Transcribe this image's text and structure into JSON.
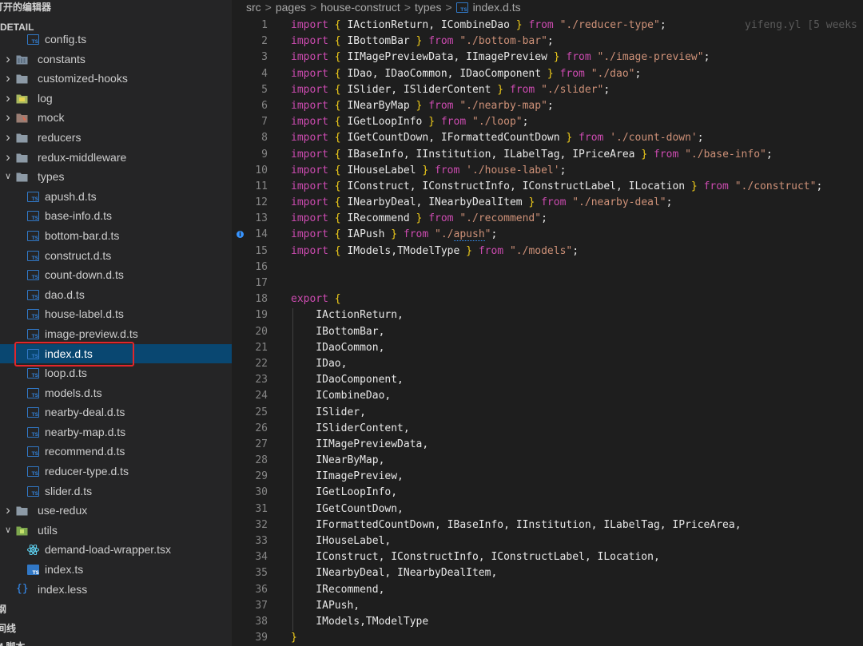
{
  "sidebar": {
    "open_editors_title": "打开的编辑器",
    "project_title": "-DETAIL",
    "outline_title": "纲",
    "timeline_title": "间线",
    "npm_title": "M 脚本",
    "items": [
      {
        "label": "config.ts",
        "kind": "ts",
        "depth": 2
      },
      {
        "label": "constants",
        "kind": "folder-blue",
        "depth": 1,
        "expand": "closed"
      },
      {
        "label": "customized-hooks",
        "kind": "folder",
        "depth": 1,
        "expand": "closed"
      },
      {
        "label": "log",
        "kind": "folder-log",
        "depth": 1,
        "expand": "closed"
      },
      {
        "label": "mock",
        "kind": "folder-mock",
        "depth": 1,
        "expand": "closed"
      },
      {
        "label": "reducers",
        "kind": "folder",
        "depth": 1,
        "expand": "closed"
      },
      {
        "label": "redux-middleware",
        "kind": "folder",
        "depth": 1,
        "expand": "closed"
      },
      {
        "label": "types",
        "kind": "folder",
        "depth": 1,
        "expand": "open"
      },
      {
        "label": "apush.d.ts",
        "kind": "ts",
        "depth": 2
      },
      {
        "label": "base-info.d.ts",
        "kind": "ts",
        "depth": 2
      },
      {
        "label": "bottom-bar.d.ts",
        "kind": "ts",
        "depth": 2
      },
      {
        "label": "construct.d.ts",
        "kind": "ts",
        "depth": 2
      },
      {
        "label": "count-down.d.ts",
        "kind": "ts",
        "depth": 2
      },
      {
        "label": "dao.d.ts",
        "kind": "ts",
        "depth": 2
      },
      {
        "label": "house-label.d.ts",
        "kind": "ts",
        "depth": 2
      },
      {
        "label": "image-preview.d.ts",
        "kind": "ts",
        "depth": 2
      },
      {
        "label": "index.d.ts",
        "kind": "ts",
        "depth": 2,
        "selected": true
      },
      {
        "label": "loop.d.ts",
        "kind": "ts",
        "depth": 2
      },
      {
        "label": "models.d.ts",
        "kind": "ts",
        "depth": 2
      },
      {
        "label": "nearby-deal.d.ts",
        "kind": "ts",
        "depth": 2
      },
      {
        "label": "nearby-map.d.ts",
        "kind": "ts",
        "depth": 2
      },
      {
        "label": "recommend.d.ts",
        "kind": "ts",
        "depth": 2
      },
      {
        "label": "reducer-type.d.ts",
        "kind": "ts",
        "depth": 2
      },
      {
        "label": "slider.d.ts",
        "kind": "ts",
        "depth": 2
      },
      {
        "label": "use-redux",
        "kind": "folder",
        "depth": 1,
        "expand": "closed"
      },
      {
        "label": "utils",
        "kind": "folder-utils",
        "depth": 1,
        "expand": "open"
      },
      {
        "label": "demand-load-wrapper.tsx",
        "kind": "react",
        "depth": 2
      },
      {
        "label": "index.ts",
        "kind": "ts-solid",
        "depth": 2
      },
      {
        "label": "index.less",
        "kind": "braces",
        "depth": 1
      }
    ],
    "ts_badge": "TS",
    "braces_glyph": "{}"
  },
  "breadcrumb": {
    "items": [
      "src",
      "pages",
      "house-construct",
      "types",
      "index.d.ts"
    ],
    "separator": ">",
    "file_badge": "TS"
  },
  "editor": {
    "blame_text": "yifeng.yl [5 weeks",
    "info_glyph": "i",
    "info_line": 14,
    "lines": [
      {
        "n": "1",
        "seg": [
          [
            "kw",
            "import"
          ],
          [
            "t",
            " "
          ],
          [
            "br",
            "{"
          ],
          [
            "t",
            " IActionReturn, ICombineDao "
          ],
          [
            "br",
            "}"
          ],
          [
            "t",
            " "
          ],
          [
            "kw",
            "from"
          ],
          [
            "t",
            " "
          ],
          [
            "str",
            "\"./reducer-type\""
          ],
          [
            "t",
            ";"
          ]
        ]
      },
      {
        "n": "2",
        "seg": [
          [
            "kw",
            "import"
          ],
          [
            "t",
            " "
          ],
          [
            "br",
            "{"
          ],
          [
            "t",
            " IBottomBar "
          ],
          [
            "br",
            "}"
          ],
          [
            "t",
            " "
          ],
          [
            "kw",
            "from"
          ],
          [
            "t",
            " "
          ],
          [
            "str",
            "\"./bottom-bar\""
          ],
          [
            "t",
            ";"
          ]
        ]
      },
      {
        "n": "3",
        "seg": [
          [
            "kw",
            "import"
          ],
          [
            "t",
            " "
          ],
          [
            "br",
            "{"
          ],
          [
            "t",
            " IIMagePreviewData, IImagePreview "
          ],
          [
            "br",
            "}"
          ],
          [
            "t",
            " "
          ],
          [
            "kw",
            "from"
          ],
          [
            "t",
            " "
          ],
          [
            "str",
            "\"./image-preview\""
          ],
          [
            "t",
            ";"
          ]
        ]
      },
      {
        "n": "4",
        "seg": [
          [
            "kw",
            "import"
          ],
          [
            "t",
            " "
          ],
          [
            "br",
            "{"
          ],
          [
            "t",
            " IDao, IDaoCommon, IDaoComponent "
          ],
          [
            "br",
            "}"
          ],
          [
            "t",
            " "
          ],
          [
            "kw",
            "from"
          ],
          [
            "t",
            " "
          ],
          [
            "str",
            "\"./dao\""
          ],
          [
            "t",
            ";"
          ]
        ]
      },
      {
        "n": "5",
        "seg": [
          [
            "kw",
            "import"
          ],
          [
            "t",
            " "
          ],
          [
            "br",
            "{"
          ],
          [
            "t",
            " ISlider, ISliderContent "
          ],
          [
            "br",
            "}"
          ],
          [
            "t",
            " "
          ],
          [
            "kw",
            "from"
          ],
          [
            "t",
            " "
          ],
          [
            "str",
            "\"./slider\""
          ],
          [
            "t",
            ";"
          ]
        ]
      },
      {
        "n": "6",
        "seg": [
          [
            "kw",
            "import"
          ],
          [
            "t",
            " "
          ],
          [
            "br",
            "{"
          ],
          [
            "t",
            " INearByMap "
          ],
          [
            "br",
            "}"
          ],
          [
            "t",
            " "
          ],
          [
            "kw",
            "from"
          ],
          [
            "t",
            " "
          ],
          [
            "str",
            "\"./nearby-map\""
          ],
          [
            "t",
            ";"
          ]
        ]
      },
      {
        "n": "7",
        "seg": [
          [
            "kw",
            "import"
          ],
          [
            "t",
            " "
          ],
          [
            "br",
            "{"
          ],
          [
            "t",
            " IGetLoopInfo "
          ],
          [
            "br",
            "}"
          ],
          [
            "t",
            " "
          ],
          [
            "kw",
            "from"
          ],
          [
            "t",
            " "
          ],
          [
            "str",
            "\"./loop\""
          ],
          [
            "t",
            ";"
          ]
        ]
      },
      {
        "n": "8",
        "seg": [
          [
            "kw",
            "import"
          ],
          [
            "t",
            " "
          ],
          [
            "br",
            "{"
          ],
          [
            "t",
            " IGetCountDown, IFormattedCountDown "
          ],
          [
            "br",
            "}"
          ],
          [
            "t",
            " "
          ],
          [
            "kw",
            "from"
          ],
          [
            "t",
            " "
          ],
          [
            "str",
            "'./count-down'"
          ],
          [
            "t",
            ";"
          ]
        ]
      },
      {
        "n": "9",
        "seg": [
          [
            "kw",
            "import"
          ],
          [
            "t",
            " "
          ],
          [
            "br",
            "{"
          ],
          [
            "t",
            " IBaseInfo, IInstitution, ILabelTag, IPriceArea "
          ],
          [
            "br",
            "}"
          ],
          [
            "t",
            " "
          ],
          [
            "kw",
            "from"
          ],
          [
            "t",
            " "
          ],
          [
            "str",
            "\"./base-info\""
          ],
          [
            "t",
            ";"
          ]
        ]
      },
      {
        "n": "10",
        "seg": [
          [
            "kw",
            "import"
          ],
          [
            "t",
            " "
          ],
          [
            "br",
            "{"
          ],
          [
            "t",
            " IHouseLabel "
          ],
          [
            "br",
            "}"
          ],
          [
            "t",
            " "
          ],
          [
            "kw",
            "from"
          ],
          [
            "t",
            " "
          ],
          [
            "str",
            "'./house-label'"
          ],
          [
            "t",
            ";"
          ]
        ]
      },
      {
        "n": "11",
        "seg": [
          [
            "kw",
            "import"
          ],
          [
            "t",
            " "
          ],
          [
            "br",
            "{"
          ],
          [
            "t",
            " IConstruct, IConstructInfo, IConstructLabel, ILocation "
          ],
          [
            "br",
            "}"
          ],
          [
            "t",
            " "
          ],
          [
            "kw",
            "from"
          ],
          [
            "t",
            " "
          ],
          [
            "str",
            "\"./construct\""
          ],
          [
            "t",
            ";"
          ]
        ]
      },
      {
        "n": "12",
        "seg": [
          [
            "kw",
            "import"
          ],
          [
            "t",
            " "
          ],
          [
            "br",
            "{"
          ],
          [
            "t",
            " INearbyDeal, INearbyDealItem "
          ],
          [
            "br",
            "}"
          ],
          [
            "t",
            " "
          ],
          [
            "kw",
            "from"
          ],
          [
            "t",
            " "
          ],
          [
            "str",
            "\"./nearby-deal\""
          ],
          [
            "t",
            ";"
          ]
        ]
      },
      {
        "n": "13",
        "seg": [
          [
            "kw",
            "import"
          ],
          [
            "t",
            " "
          ],
          [
            "br",
            "{"
          ],
          [
            "t",
            " IRecommend "
          ],
          [
            "br",
            "}"
          ],
          [
            "t",
            " "
          ],
          [
            "kw",
            "from"
          ],
          [
            "t",
            " "
          ],
          [
            "str",
            "\"./recommend\""
          ],
          [
            "t",
            ";"
          ]
        ]
      },
      {
        "n": "14",
        "seg": [
          [
            "kw",
            "import"
          ],
          [
            "t",
            " "
          ],
          [
            "br",
            "{"
          ],
          [
            "t",
            " IAPush "
          ],
          [
            "br",
            "}"
          ],
          [
            "t",
            " "
          ],
          [
            "kw",
            "from"
          ],
          [
            "t",
            " "
          ],
          [
            "str",
            "\"./"
          ],
          [
            "sq",
            "apush"
          ],
          [
            "str",
            "\""
          ],
          [
            "t",
            ";"
          ]
        ]
      },
      {
        "n": "15",
        "seg": [
          [
            "kw",
            "import"
          ],
          [
            "t",
            " "
          ],
          [
            "br",
            "{"
          ],
          [
            "t",
            " IModels,TModelType "
          ],
          [
            "br",
            "}"
          ],
          [
            "t",
            " "
          ],
          [
            "kw",
            "from"
          ],
          [
            "t",
            " "
          ],
          [
            "str",
            "\"./models\""
          ],
          [
            "t",
            ";"
          ]
        ]
      },
      {
        "n": "16",
        "seg": []
      },
      {
        "n": "17",
        "seg": []
      },
      {
        "n": "18",
        "seg": [
          [
            "kw",
            "export"
          ],
          [
            "t",
            " "
          ],
          [
            "br",
            "{"
          ]
        ]
      },
      {
        "n": "19",
        "seg": [
          [
            "t",
            "    IActionReturn,"
          ]
        ]
      },
      {
        "n": "20",
        "seg": [
          [
            "t",
            "    IBottomBar,"
          ]
        ]
      },
      {
        "n": "21",
        "seg": [
          [
            "t",
            "    IDaoCommon,"
          ]
        ]
      },
      {
        "n": "22",
        "seg": [
          [
            "t",
            "    IDao,"
          ]
        ]
      },
      {
        "n": "23",
        "seg": [
          [
            "t",
            "    IDaoComponent,"
          ]
        ]
      },
      {
        "n": "24",
        "seg": [
          [
            "t",
            "    ICombineDao,"
          ]
        ]
      },
      {
        "n": "25",
        "seg": [
          [
            "t",
            "    ISlider,"
          ]
        ]
      },
      {
        "n": "26",
        "seg": [
          [
            "t",
            "    ISliderContent,"
          ]
        ]
      },
      {
        "n": "27",
        "seg": [
          [
            "t",
            "    IIMagePreviewData,"
          ]
        ]
      },
      {
        "n": "28",
        "seg": [
          [
            "t",
            "    INearByMap,"
          ]
        ]
      },
      {
        "n": "29",
        "seg": [
          [
            "t",
            "    IImagePreview,"
          ]
        ]
      },
      {
        "n": "30",
        "seg": [
          [
            "t",
            "    IGetLoopInfo,"
          ]
        ]
      },
      {
        "n": "31",
        "seg": [
          [
            "t",
            "    IGetCountDown,"
          ]
        ]
      },
      {
        "n": "32",
        "seg": [
          [
            "t",
            "    IFormattedCountDown, IBaseInfo, IInstitution, ILabelTag, IPriceArea,"
          ]
        ]
      },
      {
        "n": "33",
        "seg": [
          [
            "t",
            "    IHouseLabel,"
          ]
        ]
      },
      {
        "n": "34",
        "seg": [
          [
            "t",
            "    IConstruct, IConstructInfo, IConstructLabel, ILocation,"
          ]
        ]
      },
      {
        "n": "35",
        "seg": [
          [
            "t",
            "    INearbyDeal, INearbyDealItem,"
          ]
        ]
      },
      {
        "n": "36",
        "seg": [
          [
            "t",
            "    IRecommend,"
          ]
        ]
      },
      {
        "n": "37",
        "seg": [
          [
            "t",
            "    IAPush,"
          ]
        ]
      },
      {
        "n": "38",
        "seg": [
          [
            "t",
            "    IModels,TModelType"
          ]
        ]
      },
      {
        "n": "39",
        "seg": [
          [
            "br",
            "}"
          ]
        ]
      }
    ]
  },
  "colors": {
    "keyword": "#cc4bb0",
    "bracket": "#f2ce1a",
    "string": "#ce9178",
    "ts_icon": "#3178c6",
    "selection": "#094771",
    "highlight_box": "#e2262b"
  }
}
